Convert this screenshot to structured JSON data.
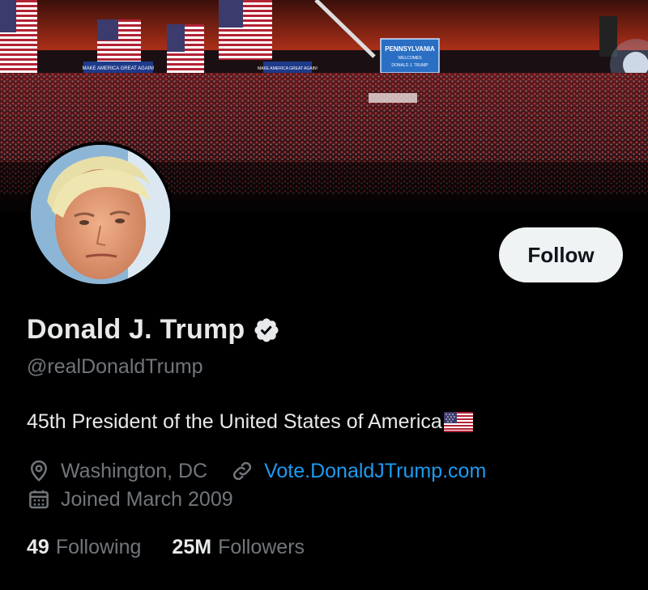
{
  "banner": {
    "description_icon": "rally-crowd-photo",
    "sign_main": "PENNSYLVANIA",
    "sign_sub1": "WELCOMES",
    "sign_sub2": "DONALD J. TRUMP",
    "stage_banner_left": "MAKE AMERICA GREAT AGAIN!",
    "stage_banner_right": "MAKE AMERICA GREAT AGAIN!"
  },
  "profile": {
    "display_name": "Donald J. Trump",
    "handle": "@realDonaldTrump",
    "verified_icon": "verified-badge-icon",
    "bio": "45th President of the United States of America",
    "bio_emoji": "us-flag-emoji",
    "location": "Washington, DC",
    "website": "Vote.DonaldJTrump.com",
    "joined": "Joined March 2009"
  },
  "actions": {
    "follow_label": "Follow"
  },
  "stats": {
    "following_count": "49",
    "following_label": "Following",
    "followers_count": "25M",
    "followers_label": "Followers"
  },
  "colors": {
    "background": "#000000",
    "primary_text": "#e7e9ea",
    "secondary_text": "#71767b",
    "link": "#1d9bf0",
    "button_bg": "#eff3f4"
  }
}
